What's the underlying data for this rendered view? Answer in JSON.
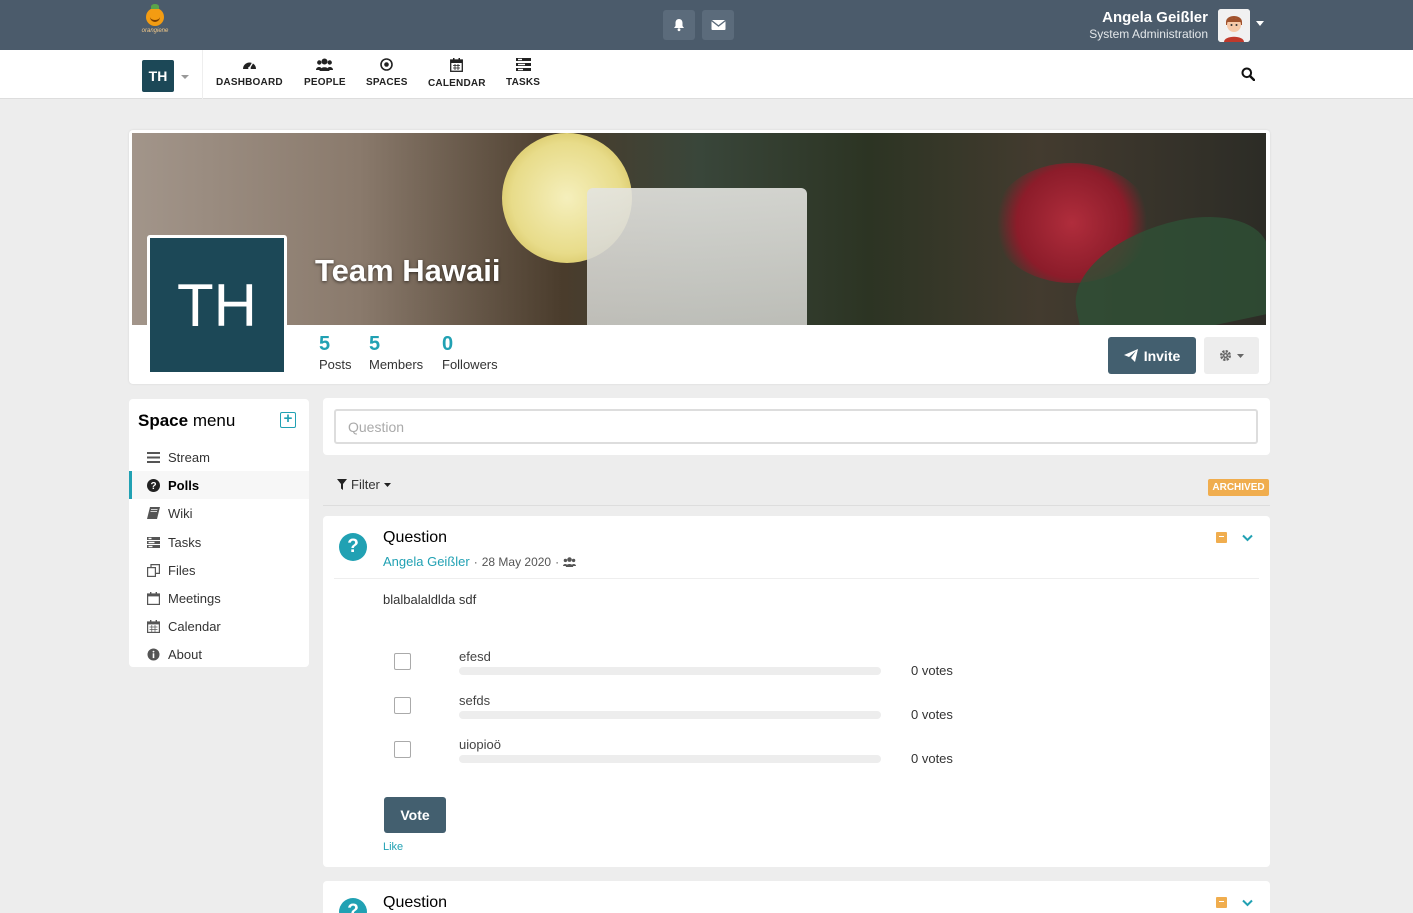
{
  "topbar": {
    "logo_text": "orangiene",
    "user_name": "Angela Geißler",
    "user_role": "System Administration"
  },
  "nav": {
    "space_initials": "TH",
    "items": [
      {
        "label": "DASHBOARD",
        "icon": "dashboard-icon"
      },
      {
        "label": "PEOPLE",
        "icon": "people-icon"
      },
      {
        "label": "SPACES",
        "icon": "spaces-icon"
      },
      {
        "label": "CALENDAR",
        "icon": "calendar-icon"
      },
      {
        "label": "TASKS",
        "icon": "tasks-icon"
      }
    ]
  },
  "space": {
    "title": "Team Hawaii",
    "initials": "TH",
    "stats": [
      {
        "value": "5",
        "label": "Posts"
      },
      {
        "value": "5",
        "label": "Members"
      },
      {
        "value": "0",
        "label": "Followers"
      }
    ],
    "invite_label": "Invite"
  },
  "side_menu": {
    "title_bold": "Space",
    "title_rest": " menu",
    "items": [
      {
        "label": "Stream",
        "icon": "stream-icon"
      },
      {
        "label": "Polls",
        "icon": "question-circle-icon",
        "active": true
      },
      {
        "label": "Wiki",
        "icon": "book-icon"
      },
      {
        "label": "Tasks",
        "icon": "tasks-icon"
      },
      {
        "label": "Files",
        "icon": "files-icon"
      },
      {
        "label": "Meetings",
        "icon": "calendar-blank-icon"
      },
      {
        "label": "Calendar",
        "icon": "calendar-icon"
      },
      {
        "label": "About",
        "icon": "info-icon"
      }
    ]
  },
  "form": {
    "question_placeholder": "Question"
  },
  "filter": {
    "label": "Filter",
    "archived_badge": "ARCHIVED"
  },
  "polls": [
    {
      "title": "Question",
      "author": "Angela Geißler",
      "date": "28 May 2020",
      "separator": "·",
      "question": "blalbalaldlda sdf",
      "answers": [
        {
          "label": "efesd",
          "votes": "0 votes",
          "percent": 0
        },
        {
          "label": "sefds",
          "votes": "0 votes",
          "percent": 0
        },
        {
          "label": "uiopioö",
          "votes": "0 votes",
          "percent": 0
        }
      ],
      "vote_label": "Vote",
      "like_label": "Like"
    },
    {
      "title": "Question"
    }
  ],
  "colors": {
    "topbar": "#4b5b6b",
    "accent": "#21a1b3",
    "space_avatar": "#1c4857",
    "button": "#435f6f",
    "archived": "#f0ad4e"
  }
}
